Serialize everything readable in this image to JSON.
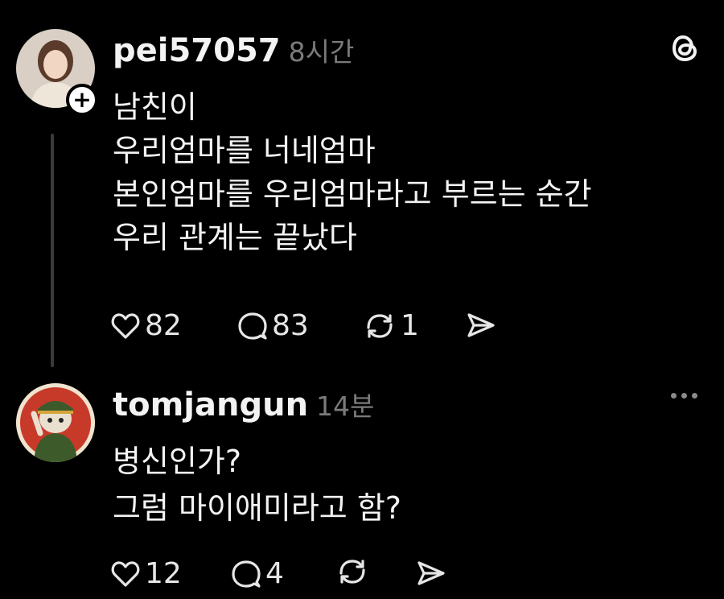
{
  "post": {
    "username": "pei57057",
    "time": "8시간",
    "lines": [
      "남친이",
      "우리엄마를 너네엄마",
      "본인엄마를 우리엄마라고 부르는 순간",
      "우리 관계는 끝났다"
    ],
    "likes": "82",
    "comments": "83",
    "reposts": "1"
  },
  "reply": {
    "username": "tomjangun",
    "time": "14분",
    "lines": [
      "병신인가?",
      "그럼 마이애미라고 함?"
    ],
    "likes": "12",
    "comments": "4"
  },
  "icons": {
    "app_logo": "threads-icon",
    "like": "heart-icon",
    "comment": "comment-icon",
    "repost": "repost-icon",
    "share": "send-icon",
    "more": "more-icon",
    "follow": "plus-icon"
  }
}
